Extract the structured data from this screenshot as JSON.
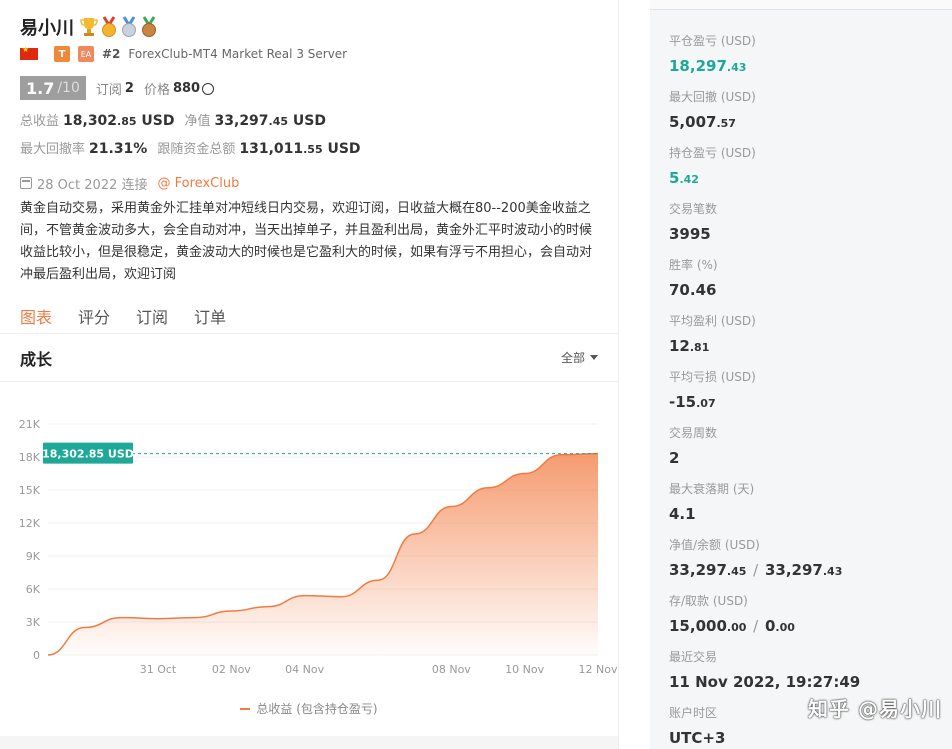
{
  "profile": {
    "name": "易小川",
    "rank": "#2",
    "server": "ForexClub-MT4 Market Real 3 Server",
    "tag_t": "T",
    "tag_ea": "EA",
    "score": "1.7",
    "score_den": "/10",
    "subscribe_label": "订阅",
    "subscribe_count": "2",
    "price_label": "价格",
    "price_value": "880",
    "total_profit_label": "总收益",
    "total_profit_int": "18,302",
    "total_profit_dec": ".85",
    "currency": "USD",
    "equity_label": "净值",
    "equity_int": "33,297",
    "equity_dec": ".45",
    "max_dd_label": "最大回撤率",
    "max_dd_value": "21.31%",
    "follow_label": "跟随资金总额",
    "follow_int": "131,011",
    "follow_dec": ".55",
    "connect_date": "28 Oct 2022 连接",
    "broker": "@ ForexClub",
    "description": "黄金自动交易，采用黄金外汇挂单对冲短线日内交易，欢迎订阅，日收益大概在80--200美金收益之间，不管黄金波动多大，会全自动对冲，当天出掉单子，并且盈利出局，黄金外汇平时波动小的时候收益比较小，但是很稳定，黄金波动大的时候也是它盈利大的时候，如果有浮亏不用担心，会自动对冲最后盈利出局，欢迎订阅"
  },
  "tabs": [
    "图表",
    "评分",
    "订阅",
    "订单"
  ],
  "chart_header": {
    "title": "成长",
    "range": "全部"
  },
  "chart_data": {
    "type": "area",
    "y_ticks": [
      "0",
      "3K",
      "6K",
      "9K",
      "12K",
      "15K",
      "18K",
      "21K"
    ],
    "x_ticks": [
      "31 Oct",
      "02 Nov",
      "04 Nov",
      "08 Nov",
      "10 Nov",
      "12 Nov"
    ],
    "ylim": [
      0,
      21000
    ],
    "current_label": "18,302.85 USD",
    "current_value": 18302.85,
    "series": [
      {
        "name": "总收益 (包含持仓盈亏)",
        "x": [
          "28 Oct",
          "29 Oct",
          "30 Oct",
          "31 Oct",
          "01 Nov",
          "02 Nov",
          "03 Nov",
          "04 Nov",
          "05 Nov",
          "06 Nov",
          "07 Nov",
          "08 Nov",
          "09 Nov",
          "10 Nov",
          "11 Nov",
          "12 Nov"
        ],
        "values": [
          0,
          2500,
          3400,
          3300,
          3400,
          4000,
          4400,
          5400,
          5300,
          6800,
          11000,
          13500,
          15200,
          16500,
          18200,
          18302.85
        ]
      }
    ],
    "line_color": "#f27a40",
    "label_bg": "#1ea897"
  },
  "metrics": [
    {
      "label": "平仓盈亏 (USD)",
      "int": "18,297",
      "dec": ".43",
      "green": true
    },
    {
      "label": "最大回撤 (USD)",
      "int": "5,007",
      "dec": ".57",
      "green": false
    },
    {
      "label": "持仓盈亏 (USD)",
      "int": "5",
      "dec": ".42",
      "green": true
    },
    {
      "label": "交易笔数",
      "int": "3995",
      "dec": "",
      "green": false
    },
    {
      "label": "胜率 (%)",
      "int": "70.46",
      "dec": "",
      "green": false
    },
    {
      "label": "平均盈利 (USD)",
      "int": "12",
      "dec": ".81",
      "green": false
    },
    {
      "label": "平均亏损 (USD)",
      "int": "-15",
      "dec": ".07",
      "green": false
    },
    {
      "label": "交易周数",
      "int": "2",
      "dec": "",
      "green": false
    },
    {
      "label": "最大衰落期 (天)",
      "int": "4.1",
      "dec": "",
      "green": false
    },
    {
      "label": "净值/余额 (USD)",
      "int": "33,297",
      "dec": ".45",
      "int2": "33,297",
      "dec2": ".43",
      "green": false
    },
    {
      "label": "存/取款 (USD)",
      "int": "15,000",
      "dec": ".00",
      "int2": "0",
      "dec2": ".00",
      "green": false
    },
    {
      "label": "最近交易",
      "int": "11 Nov 2022, 19:27:49",
      "dec": "",
      "green": false
    },
    {
      "label": "账户时区",
      "int": "UTC+3",
      "dec": "",
      "green": false
    }
  ],
  "watermark": "知乎 @易小川",
  "colors": {
    "accent": "#f27a40",
    "green": "#1ea897"
  }
}
